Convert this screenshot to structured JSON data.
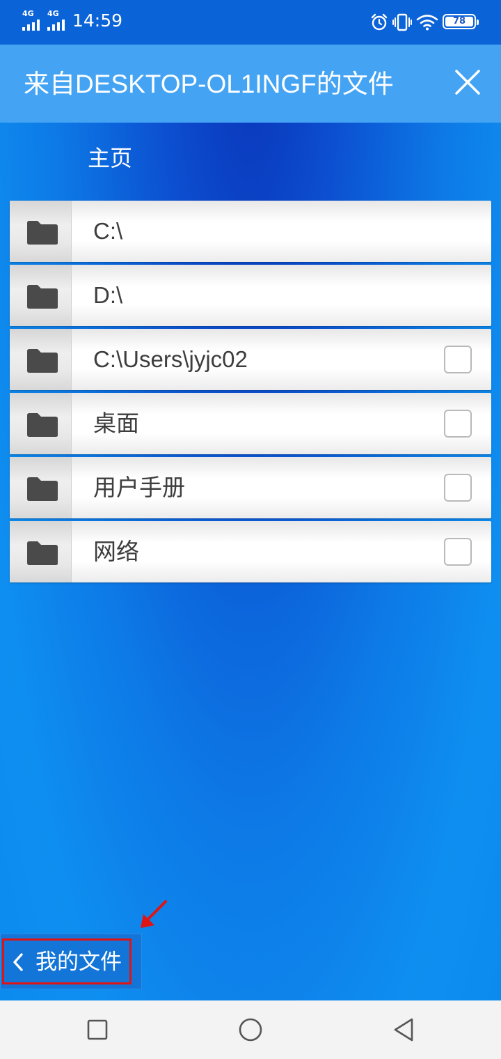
{
  "status_bar": {
    "network_1": "4G",
    "network_2": "4G",
    "time": "14:59",
    "battery": "78",
    "icons": [
      "alarm-icon",
      "vibrate-icon",
      "wifi-icon",
      "battery-icon"
    ]
  },
  "header": {
    "title": "来自DESKTOP-OL1INGF的文件",
    "close_icon": "close-icon"
  },
  "breadcrumb": {
    "home": "主页"
  },
  "folders": [
    {
      "label": "C:\\",
      "checkbox": false
    },
    {
      "label": "D:\\",
      "checkbox": false
    },
    {
      "label": "C:\\Users\\jyjc02",
      "checkbox": true,
      "checked": false
    },
    {
      "label": "桌面",
      "checkbox": true,
      "checked": false
    },
    {
      "label": "用户手册",
      "checkbox": true,
      "checked": false
    },
    {
      "label": "网络",
      "checkbox": true,
      "checked": false
    }
  ],
  "back_button": {
    "label": "我的文件",
    "icon": "chevron-left-icon"
  },
  "nav_bar": {
    "icons": [
      "recents-square-icon",
      "home-circle-icon",
      "back-triangle-icon"
    ]
  },
  "colors": {
    "header_bg": "#44a4f3",
    "status_bg": "#0b63d8",
    "annotation": "#e11414"
  }
}
